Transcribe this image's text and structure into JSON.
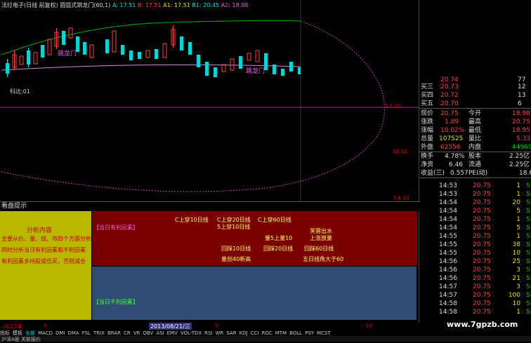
{
  "header": {
    "indicator_title": "法拉电子(日线 前复权)",
    "formula_title": "圆弧式跳龙门(60,1)",
    "a_label": "A: 17.51",
    "b_label": "B: 17.51",
    "a1_label": "A1: 17.51",
    "b1_label": "B1: 20.45",
    "a2_label": "A2: 18.98"
  },
  "chart_labels": {
    "jump_gate_1": "跳龙门",
    "jump_gate_2": "跳龙门",
    "price_low_label": "16.01",
    "price_mid_label": "17.59",
    "price_lowest_label": "14.43",
    "bottom_label": "科达:01"
  },
  "quote": {
    "sell3_label": "买三",
    "sell3_price": "20.73",
    "sell3_vol": "12",
    "sell4_label": "买四",
    "sell4_price": "20.72",
    "sell4_vol": "13",
    "sell5_label": "买五",
    "sell5_price": "20.70",
    "sell5_vol": "6",
    "top_price": "20.74",
    "top_vol": "77",
    "now_label": "现价",
    "now_val": "20.75",
    "open_label": "今开",
    "open_val": "18.98",
    "chg_label": "涨跌",
    "chg_val": "1.89",
    "high_label": "最高",
    "high_val": "20.75",
    "pct_label": "涨幅",
    "pct_val": "10.02%",
    "low_label": "最低",
    "low_val": "18.95",
    "vol_label": "总量",
    "vol_val": "107525",
    "ratio_label": "量比",
    "ratio_val": "5.33",
    "out_label": "外盘",
    "out_val": "62556",
    "in_label": "内盘",
    "in_val": "44969",
    "turn_label": "换手",
    "turn_val": "4.78%",
    "cap_label": "股本",
    "cap_val": "2.25亿",
    "nav_label": "净资",
    "nav_val": "6.46",
    "float_label": "流通",
    "float_val": "2.25亿",
    "eps_label": "收益(三)",
    "eps_val": "0.557",
    "pe_label": "PE(动)",
    "pe_val": "18.6"
  },
  "trades": [
    {
      "time": "14:53",
      "price": "20.75",
      "vol": "1",
      "dir": "S"
    },
    {
      "time": "14:53",
      "price": "20.75",
      "vol": "1",
      "dir": "S"
    },
    {
      "time": "14:54",
      "price": "20.75",
      "vol": "20",
      "dir": "S"
    },
    {
      "time": "14:54",
      "price": "20.75",
      "vol": "5",
      "dir": "S"
    },
    {
      "time": "14:54",
      "price": "20.75",
      "vol": "1",
      "dir": "S"
    },
    {
      "time": "14:54",
      "price": "20.75",
      "vol": "5",
      "dir": "S"
    },
    {
      "time": "14:55",
      "price": "20.75",
      "vol": "1",
      "dir": "S"
    },
    {
      "time": "14:55",
      "price": "20.75",
      "vol": "38",
      "dir": "S"
    },
    {
      "time": "14:55",
      "price": "20.75",
      "vol": "10",
      "dir": "S"
    },
    {
      "time": "14:56",
      "price": "20.75",
      "vol": "25",
      "dir": "S"
    },
    {
      "time": "14:56",
      "price": "20.75",
      "vol": "3",
      "dir": "S"
    },
    {
      "time": "14:56",
      "price": "20.75",
      "vol": "21",
      "dir": "S"
    },
    {
      "time": "14:57",
      "price": "20.75",
      "vol": "3",
      "dir": "S"
    },
    {
      "time": "14:57",
      "price": "20.75",
      "vol": "100",
      "dir": "S"
    },
    {
      "time": "14:58",
      "price": "20.75",
      "vol": "10",
      "dir": "S"
    },
    {
      "time": "14:58",
      "price": "20.75",
      "vol": "1",
      "dir": "S"
    }
  ],
  "hint": {
    "title": "看盘提示",
    "left_lines": [
      "分析内容",
      "主要从价、量、线、市四个方面分析",
      "同时分析当日有利因素和不利因素",
      "有利因素多持股或低买，否则减仓"
    ],
    "good_title": "【当日有利因素】",
    "bad_title": "【当日不利因素】",
    "good_items": {
      "c10": "C上穿10日线",
      "c20": "C上穿20日线",
      "c60": "C上穿60日线",
      "c5_10": "5上穿10日线",
      "vol5_10": "量5上量10",
      "gold": "芙蓉出水",
      "rise_vol": "上涨放量",
      "back10": "回踩10日线",
      "back20": "回踩20日线",
      "back60": "回踩60日线",
      "vol40": "量创40新高",
      "angle": "五日线角大于60"
    }
  },
  "timeline": {
    "year": "2013年",
    "m8": "8",
    "date": "2013/08/21/三",
    "m9": "9",
    "m10": "10"
  },
  "tabs": [
    "指标",
    "模板",
    "全部",
    "MACD",
    "DMI",
    "DMA",
    "FSL",
    "TRIX",
    "BRAR",
    "CR",
    "VR",
    "OBV",
    "ASI",
    "EMV",
    "VOL-TDX",
    "RSI",
    "WR",
    "SAR",
    "KDJ",
    "CCI",
    "ROC",
    "MTM",
    "BOLL",
    "PSY",
    "MCST"
  ],
  "status": {
    "text": "沪深A股 关联报价"
  },
  "watermark": "www.7gpzb.com",
  "colors": {
    "up": "#ff4040",
    "down": "#00e0e0",
    "ma_green": "#00c000",
    "arc": "#c040c0"
  }
}
